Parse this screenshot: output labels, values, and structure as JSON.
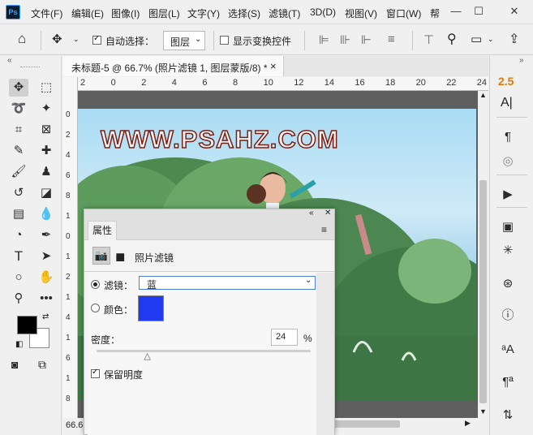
{
  "app": {
    "logo": "Ps"
  },
  "menu": [
    {
      "label": "文件(F)"
    },
    {
      "label": "编辑(E)"
    },
    {
      "label": "图像(I)"
    },
    {
      "label": "图层(L)"
    },
    {
      "label": "文字(Y)"
    },
    {
      "label": "选择(S)"
    },
    {
      "label": "滤镜(T)"
    },
    {
      "label": "3D(D)"
    },
    {
      "label": "视图(V)"
    },
    {
      "label": "窗口(W)"
    },
    {
      "label": "帮"
    }
  ],
  "window_controls": {
    "minimize": "—",
    "maximize": "☐",
    "close": "✕"
  },
  "options": {
    "auto_select_label": "自动选择：",
    "auto_select_value": "图层",
    "show_transform_label": "显示变换控件"
  },
  "tab": {
    "title": "未标题-5 @ 66.7% (照片滤镜 1, 图层蒙版/8) *",
    "close": "×"
  },
  "rulers": {
    "h_ticks": [
      "2",
      "0",
      "2",
      "4",
      "6",
      "8",
      "10",
      "12",
      "14",
      "16",
      "18",
      "20",
      "22",
      "24"
    ],
    "v_ticks": [
      "0",
      "2",
      "4",
      "6",
      "8",
      "1",
      "0",
      "1",
      "2",
      "1",
      "4",
      "1",
      "6",
      "1",
      "8"
    ]
  },
  "canvas": {
    "watermark": "WWW.PSAHZ.COM"
  },
  "status": {
    "zoom": "66.6"
  },
  "right_panel": {
    "char_label": "2.5",
    "char_icon": "A|"
  },
  "properties": {
    "tab_label": "属性",
    "adjustment_name": "照片滤镜",
    "filter_label": "滤镜：",
    "filter_value": "蓝",
    "color_label": "颜色：",
    "color_swatch": "#1f3af0",
    "density_label": "密度：",
    "density_value": "24",
    "density_unit": "%",
    "density_fraction": 0.24,
    "preserve_label": "保留明度"
  },
  "colors": {
    "foreground": "#000000",
    "background": "#ffffff",
    "accent": "#e07b00"
  }
}
